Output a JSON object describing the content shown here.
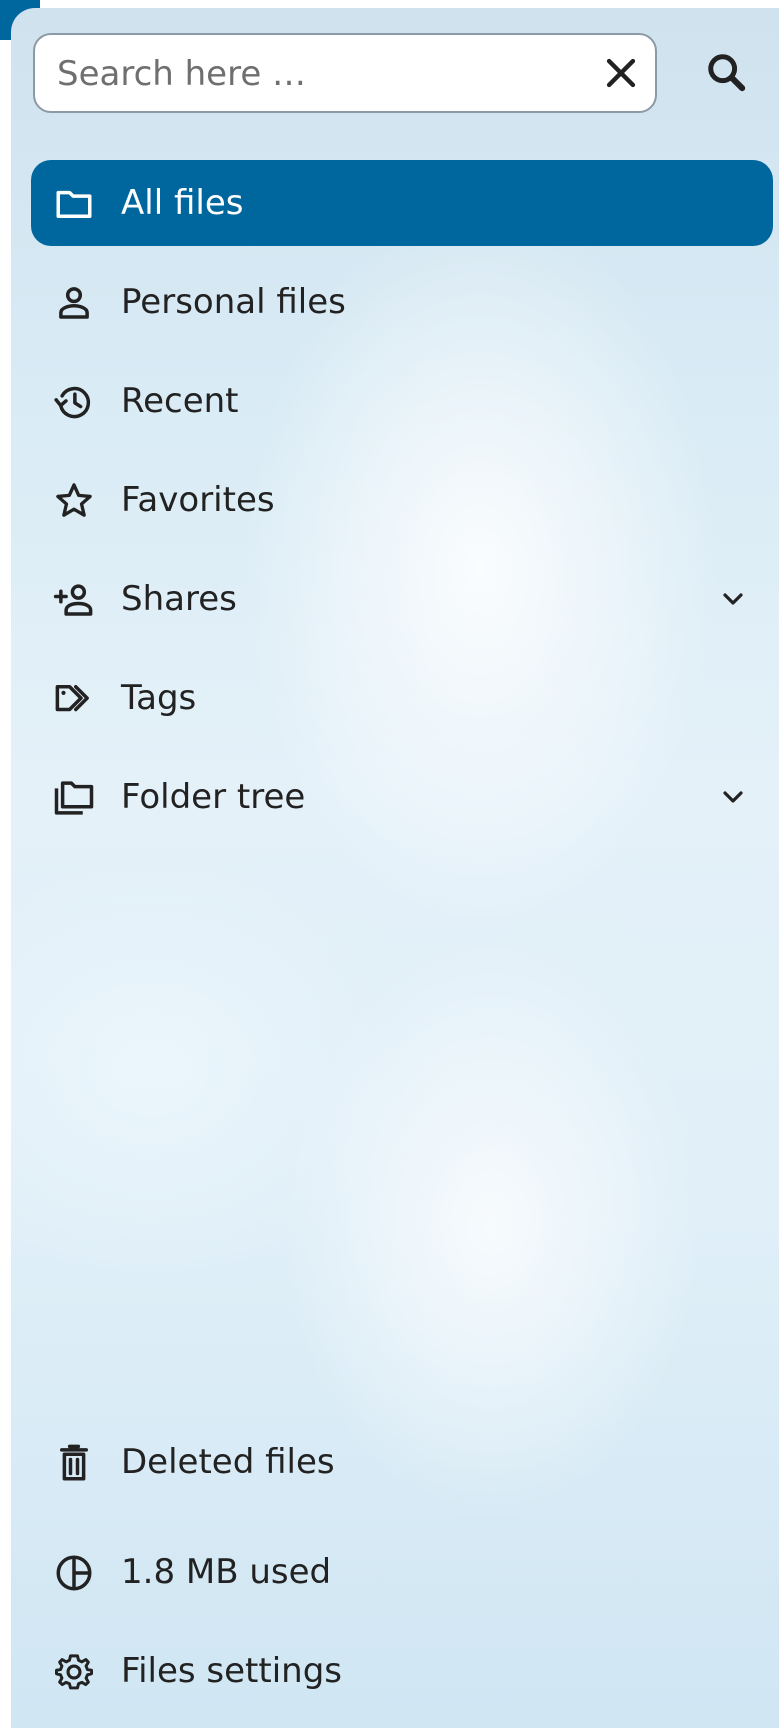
{
  "search": {
    "placeholder": "Search here …",
    "value": ""
  },
  "navigation": {
    "items": [
      {
        "label": "All files",
        "icon": "folder-icon",
        "active": true
      },
      {
        "label": "Personal files",
        "icon": "user-icon"
      },
      {
        "label": "Recent",
        "icon": "history-icon"
      },
      {
        "label": "Favorites",
        "icon": "star-icon"
      },
      {
        "label": "Shares",
        "icon": "share-user-icon",
        "expandable": true
      },
      {
        "label": "Tags",
        "icon": "tag-icon"
      },
      {
        "label": "Folder tree",
        "icon": "folder-multiple-icon",
        "expandable": true
      }
    ]
  },
  "footer": {
    "items": [
      {
        "label": "Deleted files",
        "icon": "trash-icon"
      },
      {
        "label": "1.8 MB used",
        "icon": "chart-pie-icon"
      },
      {
        "label": "Files settings",
        "icon": "gear-icon"
      }
    ]
  },
  "colors": {
    "accent": "#00679e",
    "text": "#222222",
    "active_text": "#ffffff"
  }
}
